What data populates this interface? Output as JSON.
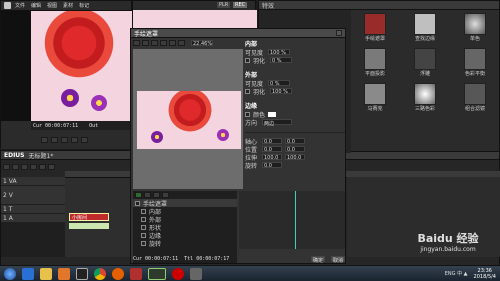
{
  "main_window": {
    "menu": [
      "文件",
      "编辑",
      "视图",
      "素材",
      "标记",
      "模式",
      "采集",
      "渲染",
      "工具",
      "设置",
      "窗口",
      "帮助"
    ],
    "badge_left": "PLR",
    "badge_right": "REC",
    "tc_cur_label": "Cur",
    "tc_cur_value": "00:00:07:11",
    "tc_in_label": "Out",
    "tc_in_value": "00:00:00:00"
  },
  "timeline_window": {
    "app_name": "EDIUS",
    "project_name": "无标题1*",
    "tracks": [
      "1 VA",
      "2 V",
      "1 T",
      "1 A"
    ],
    "clip_label": "小房间"
  },
  "layout_dialog": {
    "title": "手绘遮罩",
    "zoom": "22.46%",
    "timecode_cur": "Cur 00:00:07:11",
    "timecode_total": "Ttl 00:00:07:17",
    "sections": [
      {
        "name": "内部",
        "label1": "可见度",
        "val1": "100 %",
        "label2": "羽化",
        "val2": "0 %"
      },
      {
        "name": "外部",
        "label1": "可见度",
        "val1": "0 %",
        "label2": "羽化",
        "val2": "100 %"
      },
      {
        "name": "边缘",
        "label1": "颜色",
        "val1": "宽度",
        "label2": "方向",
        "val2": "两边"
      }
    ],
    "params": [
      {
        "label": "轴心",
        "x": "0.0",
        "y": "0.0"
      },
      {
        "label": "位置",
        "x": "0.0",
        "y": "0.0"
      },
      {
        "label": "拉伸",
        "x": "100.0",
        "y": "100.0"
      },
      {
        "label": "旋转",
        "x": "0.0",
        "y": ""
      }
    ],
    "layer_tree": [
      "手绘遮罩",
      "内部",
      "外部",
      "形状",
      "边缘",
      "旋转"
    ],
    "ok": "确定",
    "cancel": "取消"
  },
  "effects_panel": {
    "title": "特效",
    "items": [
      "手绘遮罩",
      "查找边缘",
      "单色",
      "平面投影",
      "浮雕",
      "色彩平衡",
      "马赛克",
      "三路色彩",
      "组合滤镜",
      "浮雕"
    ]
  },
  "taskbar": {
    "clock_time": "23:36",
    "clock_date": "2018/5/4",
    "watermark": "Baidu 经验",
    "watermark_url": "jingyan.baidu.com",
    "tray_text": "ENG 中 ▲"
  }
}
